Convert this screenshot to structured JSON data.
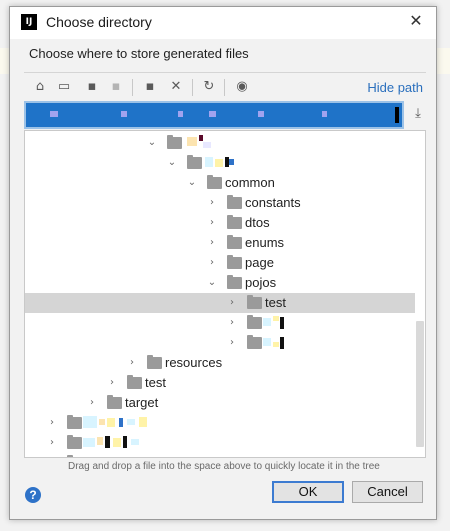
{
  "dialog": {
    "title": "Choose directory",
    "app_icon_text": "IJ",
    "close_glyph": "✕",
    "subtitle": "Choose where to store generated files"
  },
  "toolbar": {
    "home_glyph": "⌂",
    "desktop_glyph": "▭",
    "project_glyph": "▪",
    "module_glyph": "▪",
    "new_folder_glyph": "▪",
    "delete_glyph": "✕",
    "refresh_glyph": "↻",
    "show_hidden_glyph": "◉",
    "hide_path_label": "Hide path",
    "icons": [
      "home-icon",
      "desktop-icon",
      "project-directory-icon",
      "module-directory-icon",
      "new-folder-icon",
      "delete-icon",
      "refresh-icon",
      "show-hidden-files-icon"
    ]
  },
  "path": {
    "download_glyph": "⤓",
    "value_redacted": true
  },
  "tree": {
    "rows": [
      {
        "label": "",
        "expanded": true
      },
      {
        "label": "",
        "expanded": true
      },
      {
        "label": "common",
        "expanded": true
      },
      {
        "label": "constants",
        "expanded": false
      },
      {
        "label": "dtos",
        "expanded": false
      },
      {
        "label": "enums",
        "expanded": false
      },
      {
        "label": "page",
        "expanded": false
      },
      {
        "label": "pojos",
        "expanded": true
      },
      {
        "label": "test",
        "expanded": false,
        "selected": true
      },
      {
        "label": "",
        "expanded": false
      },
      {
        "label": "",
        "expanded": false
      },
      {
        "label": "resources",
        "expanded": false
      },
      {
        "label": "test",
        "expanded": false
      },
      {
        "label": "target",
        "expanded": false
      },
      {
        "label": "",
        "expanded": false
      },
      {
        "label": "",
        "expanded": false
      },
      {
        "label": "",
        "expanded": false
      }
    ]
  },
  "hint_text": "Drag and drop a file into the space above to quickly locate it in the tree",
  "footer": {
    "help_glyph": "?",
    "ok_label": "OK",
    "cancel_label": "Cancel"
  },
  "colors": {
    "accent": "#2e72c8",
    "path_selection": "#1f73c8",
    "selected_row": "#d5d5d5",
    "link": "#2a6fbd"
  }
}
